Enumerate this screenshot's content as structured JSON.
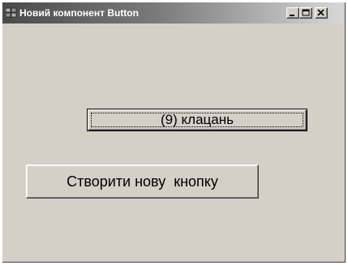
{
  "window": {
    "title": "Новий компонент Button",
    "icon": "application-icon",
    "controls": {
      "minimize_icon": "minimize-icon",
      "maximize_icon": "maximize-icon",
      "close_icon": "close-icon"
    }
  },
  "form": {
    "clicks_button_label": "(9) клацань",
    "create_button_label": "Створити нову  кнопку"
  },
  "colors": {
    "face": "#d4d0c8",
    "title_start": "#4a4a4a",
    "title_end": "#d8d8d8",
    "text": "#000000"
  }
}
